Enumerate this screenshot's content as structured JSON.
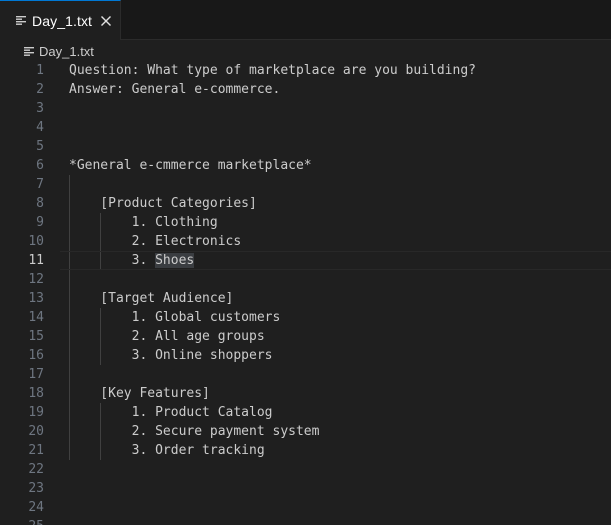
{
  "tab": {
    "label": "Day_1.txt",
    "icon": "text-file-icon",
    "close_icon": "close-icon"
  },
  "breadcrumb": {
    "label": "Day_1.txt",
    "icon": "text-file-icon"
  },
  "editor": {
    "current_line": 11,
    "lines": [
      {
        "num": "1",
        "text": "Question: What type of marketplace are you building?"
      },
      {
        "num": "2",
        "text": "Answer: General e-commerce."
      },
      {
        "num": "3",
        "text": ""
      },
      {
        "num": "4",
        "text": ""
      },
      {
        "num": "5",
        "text": ""
      },
      {
        "num": "6",
        "text": "*General e-cmmerce marketplace*"
      },
      {
        "num": "7",
        "text": ""
      },
      {
        "num": "8",
        "text": "    [Product Categories]"
      },
      {
        "num": "9",
        "text": "        1. Clothing"
      },
      {
        "num": "10",
        "text": "        2. Electronics"
      },
      {
        "num": "11",
        "text": "        3. ",
        "highlight": "Shoes"
      },
      {
        "num": "12",
        "text": ""
      },
      {
        "num": "13",
        "text": "    [Target Audience]"
      },
      {
        "num": "14",
        "text": "        1. Global customers"
      },
      {
        "num": "15",
        "text": "        2. All age groups"
      },
      {
        "num": "16",
        "text": "        3. Online shoppers"
      },
      {
        "num": "17",
        "text": ""
      },
      {
        "num": "18",
        "text": "    [Key Features]"
      },
      {
        "num": "19",
        "text": "        1. Product Catalog"
      },
      {
        "num": "20",
        "text": "        2. Secure payment system"
      },
      {
        "num": "21",
        "text": "        3. Order tracking"
      },
      {
        "num": "22",
        "text": ""
      },
      {
        "num": "23",
        "text": ""
      },
      {
        "num": "24",
        "text": ""
      },
      {
        "num": "25",
        "text": ""
      }
    ]
  },
  "colors": {
    "background": "#1f1f1f",
    "tab_accent": "#0078d4",
    "text": "#cccccc",
    "line_number": "#6e7681"
  }
}
